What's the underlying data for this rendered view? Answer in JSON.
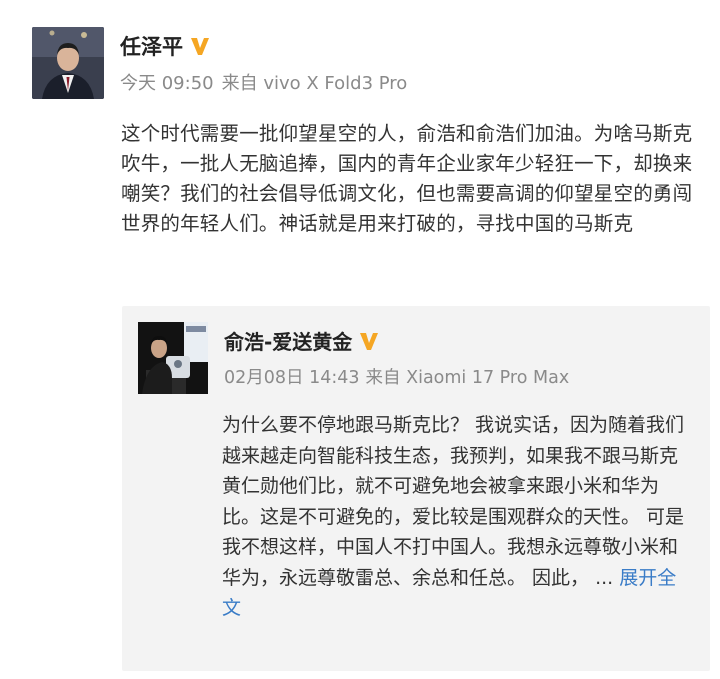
{
  "post": {
    "author": "任泽平",
    "time": "今天 09:50",
    "source": "来自 vivo X Fold3 Pro",
    "text": "这个时代需要一批仰望星空的人，俞浩和俞浩们加油。为啥马斯克吹牛，一批人无脑追捧，国内的青年企业家年少轻狂一下，却换来嘲笑？我们的社会倡导低调文化，但也需要高调的仰望星空的勇闯世界的年轻人们。神话就是用来打破的，寻找中国的马斯克"
  },
  "repost": {
    "author": "俞浩-爱送黄金",
    "time": "02月08日 14:43",
    "source": "来自 Xiaomi 17 Pro Max",
    "text": "为什么要不停地跟马斯克比？ 我说实话，因为随着我们越来越走向智能科技生态，我预判，如果我不跟马斯克黄仁勋他们比，就不可避免地会被拿来跟小米和华为比。这是不可避免的，爱比较是围观群众的天性。 可是我不想这样，中国人不打中国人。我想永远尊敬小米和华为，永远尊敬雷总、余总和任总。 因此，",
    "ellipsis": "...",
    "expand_label": "展开全文"
  },
  "colors": {
    "verified": "#f5a623",
    "link": "#3a7cc7",
    "meta": "#8a8a8a",
    "repost_bg": "#f3f3f3"
  },
  "icons": {
    "verified": "verified-v-icon"
  }
}
